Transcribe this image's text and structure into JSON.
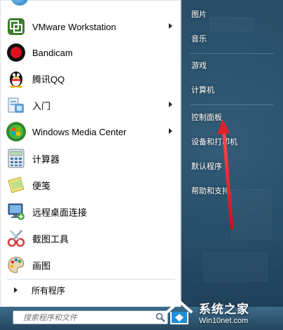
{
  "programs": [
    {
      "label": "VMware Workstation",
      "icon": "vmware-icon",
      "has_arrow": true
    },
    {
      "label": "Bandicam",
      "icon": "bandicam-icon",
      "has_arrow": false
    },
    {
      "label": "腾讯QQ",
      "icon": "qq-penguin-icon",
      "has_arrow": false
    },
    {
      "label": "入门",
      "icon": "getting-started-icon",
      "has_arrow": true
    },
    {
      "label": "Windows Media Center",
      "icon": "windows-media-center-icon",
      "has_arrow": true
    },
    {
      "label": "计算器",
      "icon": "calculator-icon",
      "has_arrow": false
    },
    {
      "label": "便笺",
      "icon": "sticky-notes-icon",
      "has_arrow": false
    },
    {
      "label": "远程桌面连接",
      "icon": "remote-desktop-icon",
      "has_arrow": false
    },
    {
      "label": "截图工具",
      "icon": "snipping-tool-icon",
      "has_arrow": false
    },
    {
      "label": "画图",
      "icon": "paint-icon",
      "has_arrow": false
    }
  ],
  "all_programs_label": "所有程序",
  "search": {
    "placeholder": "搜索程序和文件"
  },
  "right_links": [
    {
      "label": "图片"
    },
    {
      "label": "音乐"
    },
    {
      "label": "游戏"
    },
    {
      "label": "计算机"
    },
    {
      "label": "控制面板"
    },
    {
      "label": "设备和打印机"
    },
    {
      "label": "默认程序"
    },
    {
      "label": "帮助和支持"
    }
  ],
  "watermark": {
    "title": "系统之家",
    "url": "Win10net.com"
  },
  "colors": {
    "arrow_red": "#e0202a",
    "right_text": "#ffffff",
    "wm_accent": "#1e8fd8"
  }
}
